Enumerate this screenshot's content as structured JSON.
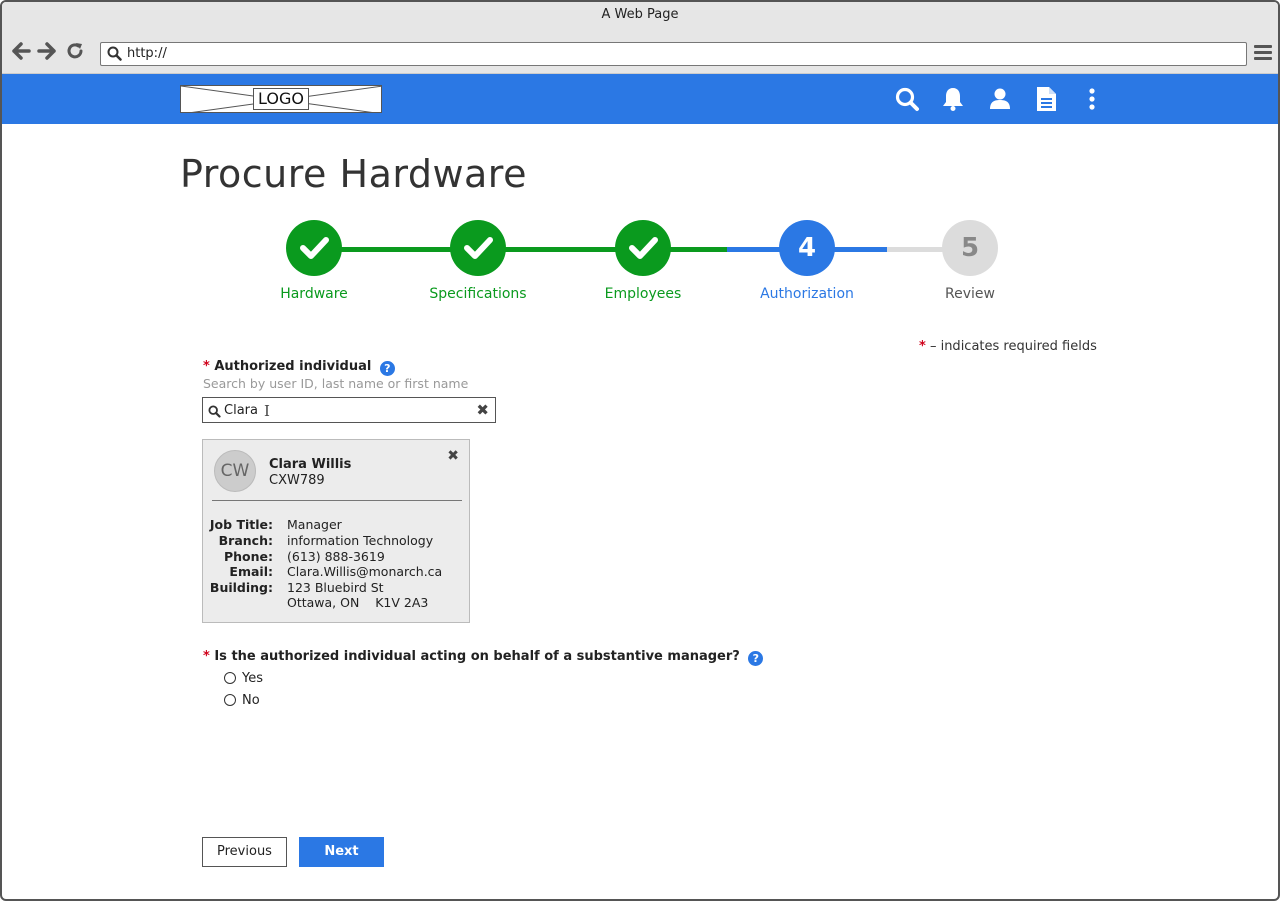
{
  "browser": {
    "title": "A Web Page",
    "url": "http://"
  },
  "appbar": {
    "logo_text": "LOGO",
    "icons": [
      "search-icon",
      "bell-icon",
      "user-icon",
      "document-icon",
      "more-vertical-icon"
    ],
    "color": "#2b78e4"
  },
  "page": {
    "title": "Procure Hardware"
  },
  "stepper": {
    "steps": [
      {
        "label": "Hardware",
        "status": "complete",
        "number": "1"
      },
      {
        "label": "Specifications",
        "status": "complete",
        "number": "2"
      },
      {
        "label": "Employees",
        "status": "complete",
        "number": "3"
      },
      {
        "label": "Authorization",
        "status": "current",
        "number": "4"
      },
      {
        "label": "Review",
        "status": "upcoming",
        "number": "5"
      }
    ],
    "colors": {
      "complete": "#0a9a1e",
      "current": "#2b78e4",
      "upcoming": "#dcdcdc"
    }
  },
  "form": {
    "required_star": "*",
    "required_note": "– indicates required fields",
    "authorized_label": "Authorized individual",
    "authorized_hint": "Search by user ID, last name or first name",
    "search_value": "Clara",
    "help_glyph": "?",
    "clear_glyph": "✖"
  },
  "person_card": {
    "initials": "CW",
    "name": "Clara Willis",
    "user_id": "CXW789",
    "close_glyph": "✖",
    "details": [
      {
        "key": "Job Title:",
        "value": "Manager"
      },
      {
        "key": "Branch:",
        "value": "information Technology"
      },
      {
        "key": "Phone:",
        "value": "(613) 888-3619"
      },
      {
        "key": "Email:",
        "value": "Clara.Willis@monarch.ca"
      },
      {
        "key": "Building:",
        "value": "123 Bluebird St"
      },
      {
        "key": "",
        "value": "Ottawa, ON    K1V 2A3"
      }
    ]
  },
  "question": {
    "text": "Is the authorized individual acting on behalf of a substantive manager?",
    "options": [
      {
        "label": "Yes",
        "selected": false
      },
      {
        "label": "No",
        "selected": false
      }
    ]
  },
  "buttons": {
    "previous": "Previous",
    "next": "Next"
  }
}
